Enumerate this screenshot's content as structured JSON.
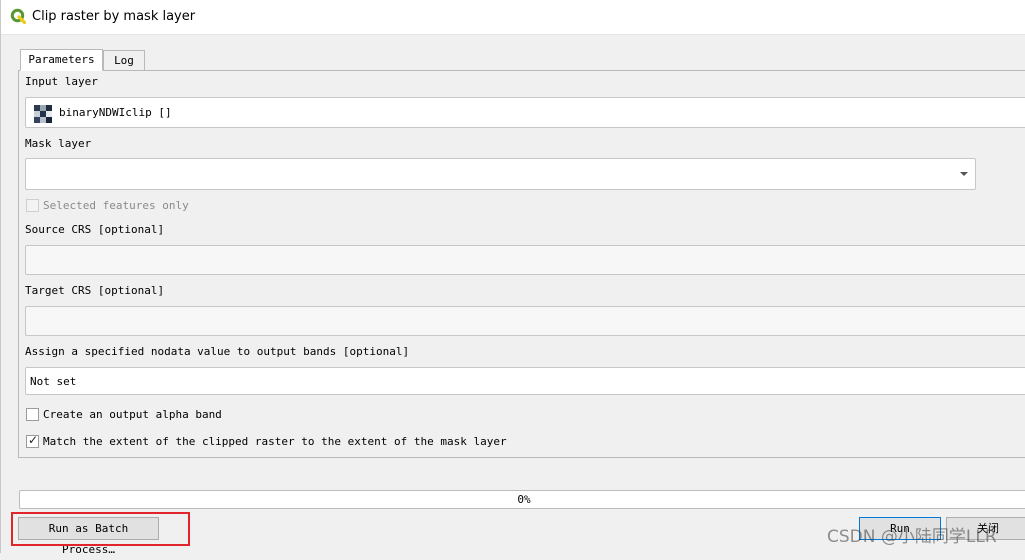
{
  "window": {
    "title": "Clip raster by mask layer"
  },
  "tabs": [
    {
      "label": "Parameters",
      "active": true
    },
    {
      "label": "Log",
      "active": false
    }
  ],
  "params": {
    "input_layer_label": "Input layer",
    "input_layer_value": "binaryNDWIclip []",
    "mask_layer_label": "Mask layer",
    "mask_layer_value": "",
    "selected_features_label": "Selected features only",
    "selected_features_checked": false,
    "source_crs_label": "Source CRS [optional]",
    "source_crs_value": "",
    "target_crs_label": "Target CRS [optional]",
    "target_crs_value": "",
    "nodata_label": "Assign a specified nodata value to output bands [optional]",
    "nodata_value": "Not set",
    "alpha_band_label": "Create an output alpha band",
    "alpha_band_checked": false,
    "match_extent_label": "Match the extent of the clipped raster to the extent of the mask layer",
    "match_extent_checked": true
  },
  "progress": {
    "text": "0%",
    "value": 0
  },
  "buttons": {
    "batch": "Run as Batch Process…",
    "run": "Run",
    "close": "关闭"
  },
  "watermark": "CSDN @小陆同学LLR",
  "colors": {
    "qgis_green": "#589632",
    "qgis_yellow": "#eec90d",
    "iterate_green": "#3fa33a",
    "highlight_red": "#e0262a",
    "primary_border": "#0078d7"
  },
  "icons": {
    "app": "qgis-logo-icon",
    "layer": "raster-layer-icon",
    "mask_iterate": "iterate-features-icon",
    "dropdown": "chevron-down-icon",
    "check": "checkmark-icon"
  }
}
